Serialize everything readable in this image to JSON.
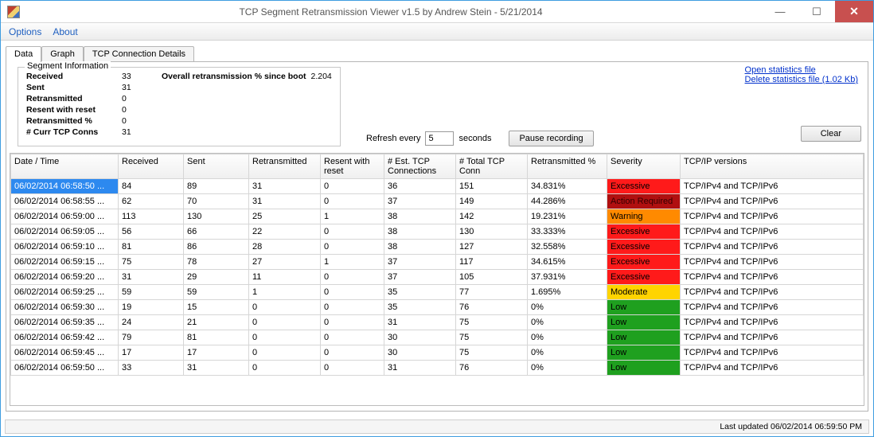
{
  "window": {
    "title": "TCP Segment Retransmission Viewer v1.5 by Andrew Stein - 5/21/2014"
  },
  "menu": {
    "options": "Options",
    "about": "About"
  },
  "tabs": {
    "data": "Data",
    "graph": "Graph",
    "details": "TCP Connection Details"
  },
  "segment_info": {
    "title": "Segment Information",
    "received_label": "Received",
    "received": "33",
    "sent_label": "Sent",
    "sent": "31",
    "retransmitted_label": "Retransmitted",
    "retransmitted": "0",
    "resent_reset_label": "Resent with reset",
    "resent_reset": "0",
    "retransmitted_pct_label": "Retransmitted %",
    "retransmitted_pct": "0",
    "curr_conns_label": "# Curr TCP Conns",
    "curr_conns": "31",
    "overall_label": "Overall retransmission % since boot",
    "overall": "2.204"
  },
  "links": {
    "open": "Open statistics file",
    "delete": "Delete statistics file (1.02 Kb)"
  },
  "refresh": {
    "label_before": "Refresh every",
    "value": "5",
    "label_after": "seconds",
    "pause": "Pause recording",
    "clear": "Clear"
  },
  "columns": {
    "c0": "Date / Time",
    "c1": "Received",
    "c2": "Sent",
    "c3": "Retransmitted",
    "c4": "Resent with reset",
    "c5": "# Est. TCP Connections",
    "c6": "# Total TCP Conn",
    "c7": "Retransmitted %",
    "c8": "Severity",
    "c9": "TCP/IP versions"
  },
  "rows": [
    {
      "dt": "06/02/2014 06:58:50 ...",
      "r": "84",
      "s": "89",
      "rt": "31",
      "rwr": "0",
      "est": "36",
      "tot": "151",
      "pct": "34.831%",
      "sev": "Excessive",
      "ver": "TCP/IPv4 and TCP/IPv6",
      "sel": true
    },
    {
      "dt": "06/02/2014 06:58:55 ...",
      "r": "62",
      "s": "70",
      "rt": "31",
      "rwr": "0",
      "est": "37",
      "tot": "149",
      "pct": "44.286%",
      "sev": "Action Required",
      "sevclass": "Action",
      "ver": "TCP/IPv4 and TCP/IPv6"
    },
    {
      "dt": "06/02/2014 06:59:00 ...",
      "r": "113",
      "s": "130",
      "rt": "25",
      "rwr": "1",
      "est": "38",
      "tot": "142",
      "pct": "19.231%",
      "sev": "Warning",
      "ver": "TCP/IPv4 and TCP/IPv6"
    },
    {
      "dt": "06/02/2014 06:59:05 ...",
      "r": "56",
      "s": "66",
      "rt": "22",
      "rwr": "0",
      "est": "38",
      "tot": "130",
      "pct": "33.333%",
      "sev": "Excessive",
      "ver": "TCP/IPv4 and TCP/IPv6"
    },
    {
      "dt": "06/02/2014 06:59:10 ...",
      "r": "81",
      "s": "86",
      "rt": "28",
      "rwr": "0",
      "est": "38",
      "tot": "127",
      "pct": "32.558%",
      "sev": "Excessive",
      "ver": "TCP/IPv4 and TCP/IPv6"
    },
    {
      "dt": "06/02/2014 06:59:15 ...",
      "r": "75",
      "s": "78",
      "rt": "27",
      "rwr": "1",
      "est": "37",
      "tot": "117",
      "pct": "34.615%",
      "sev": "Excessive",
      "ver": "TCP/IPv4 and TCP/IPv6"
    },
    {
      "dt": "06/02/2014 06:59:20 ...",
      "r": "31",
      "s": "29",
      "rt": "11",
      "rwr": "0",
      "est": "37",
      "tot": "105",
      "pct": "37.931%",
      "sev": "Excessive",
      "ver": "TCP/IPv4 and TCP/IPv6"
    },
    {
      "dt": "06/02/2014 06:59:25 ...",
      "r": "59",
      "s": "59",
      "rt": "1",
      "rwr": "0",
      "est": "35",
      "tot": "77",
      "pct": "1.695%",
      "sev": "Moderate",
      "ver": "TCP/IPv4 and TCP/IPv6"
    },
    {
      "dt": "06/02/2014 06:59:30 ...",
      "r": "19",
      "s": "15",
      "rt": "0",
      "rwr": "0",
      "est": "35",
      "tot": "76",
      "pct": "0%",
      "sev": "Low",
      "ver": "TCP/IPv4 and TCP/IPv6"
    },
    {
      "dt": "06/02/2014 06:59:35 ...",
      "r": "24",
      "s": "21",
      "rt": "0",
      "rwr": "0",
      "est": "31",
      "tot": "75",
      "pct": "0%",
      "sev": "Low",
      "ver": "TCP/IPv4 and TCP/IPv6"
    },
    {
      "dt": "06/02/2014 06:59:42 ...",
      "r": "79",
      "s": "81",
      "rt": "0",
      "rwr": "0",
      "est": "30",
      "tot": "75",
      "pct": "0%",
      "sev": "Low",
      "ver": "TCP/IPv4 and TCP/IPv6"
    },
    {
      "dt": "06/02/2014 06:59:45 ...",
      "r": "17",
      "s": "17",
      "rt": "0",
      "rwr": "0",
      "est": "30",
      "tot": "75",
      "pct": "0%",
      "sev": "Low",
      "ver": "TCP/IPv4 and TCP/IPv6"
    },
    {
      "dt": "06/02/2014 06:59:50 ...",
      "r": "33",
      "s": "31",
      "rt": "0",
      "rwr": "0",
      "est": "31",
      "tot": "76",
      "pct": "0%",
      "sev": "Low",
      "ver": "TCP/IPv4 and TCP/IPv6"
    }
  ],
  "status": "Last updated 06/02/2014 06:59:50 PM"
}
